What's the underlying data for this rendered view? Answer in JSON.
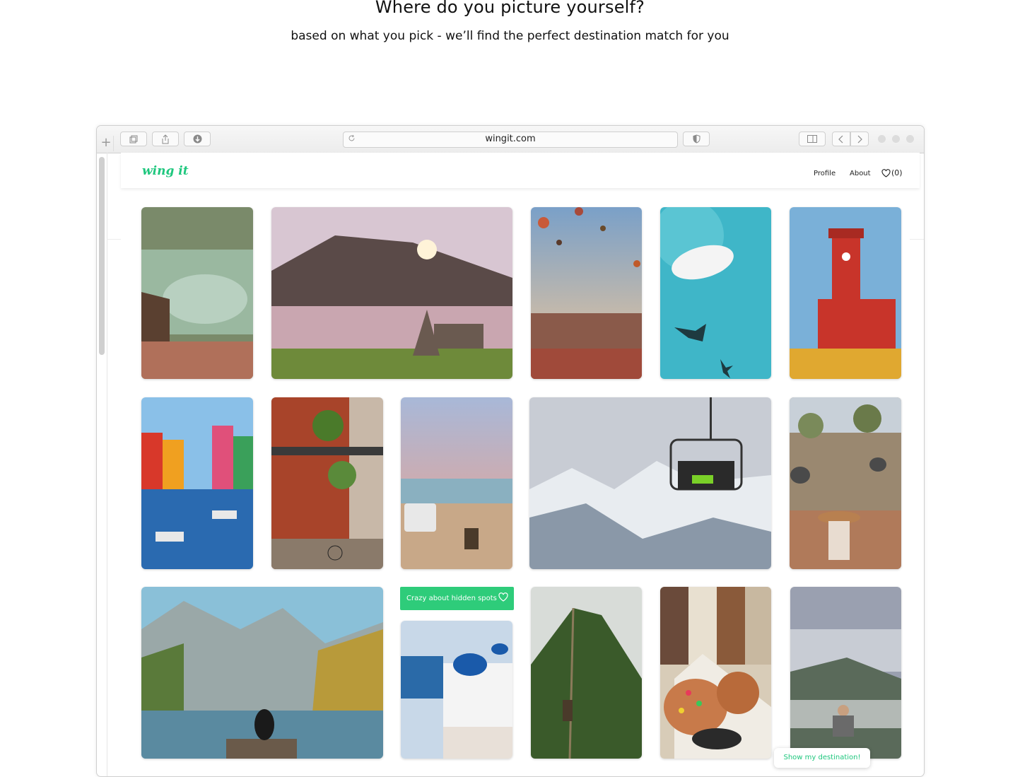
{
  "hero": {
    "title": "Where do you picture yourself?",
    "subtitle": "based on what you pick -  we’ll find the perfect destination match for you"
  },
  "browser": {
    "url": "wingit.com",
    "toolbar_icons": [
      "new-tab-icon",
      "tabs-icon",
      "share-icon",
      "download-icon",
      "reload-icon",
      "shield-icon",
      "sidebar-icon",
      "back-icon",
      "forward-icon"
    ]
  },
  "site": {
    "logo": "wing it",
    "nav": {
      "profile": "Profile",
      "about": "About",
      "favorites_count": "(0)"
    },
    "accent_color": "#1fc77e"
  },
  "gallery": {
    "tiles": [
      "cenote-pool",
      "lake-cabin-sunset",
      "hot-air-balloons",
      "boat-shark-aerial",
      "red-palace",
      "colorful-canal-houses",
      "balcony-street",
      "van-beach-sunset",
      "ski-chairlift-mountains",
      "elephants-safari",
      "fjord-lake-person",
      "santorini-domes",
      "mountain-stairs",
      "canal-houses-waffle",
      "cloudy-mountain-hiker"
    ],
    "hidden_spots_tag": "Crazy about hidden spots",
    "cta": "Show my destination!"
  }
}
